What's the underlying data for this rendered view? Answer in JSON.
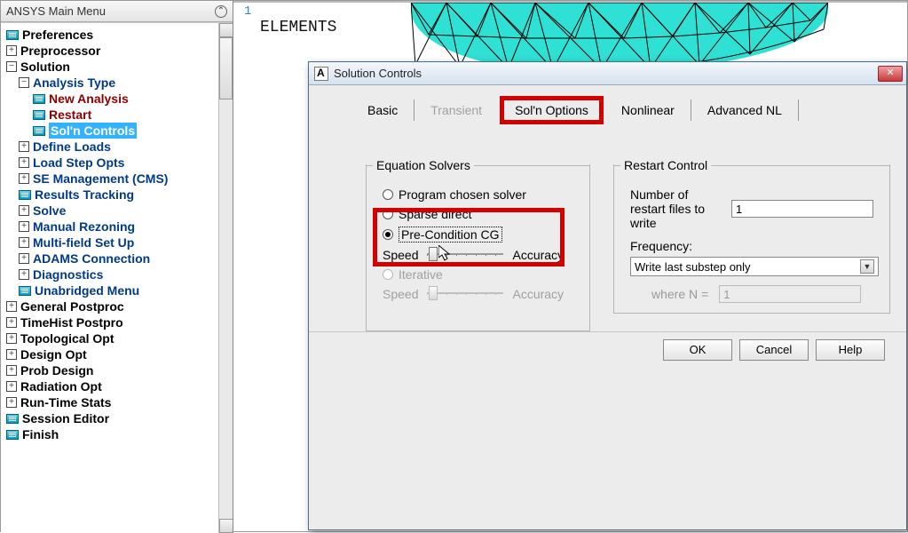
{
  "sidebar": {
    "title": "ANSYS Main Menu",
    "items": [
      {
        "label": "Preferences",
        "type": "leaf",
        "indent": 0
      },
      {
        "label": "Preprocessor",
        "type": "node",
        "indent": 0,
        "sign": "+"
      },
      {
        "label": "Solution",
        "type": "node",
        "indent": 0,
        "sign": "−"
      },
      {
        "label": "Analysis Type",
        "type": "node",
        "indent": 1,
        "sign": "−",
        "cls": "blue"
      },
      {
        "label": "New Analysis",
        "type": "leaf",
        "indent": 2,
        "cls": "red"
      },
      {
        "label": "Restart",
        "type": "leaf",
        "indent": 2,
        "cls": "red"
      },
      {
        "label": "Sol'n Controls",
        "type": "leaf",
        "indent": 2,
        "cls": "sel"
      },
      {
        "label": "Define Loads",
        "type": "node",
        "indent": 1,
        "sign": "+",
        "cls": "blue"
      },
      {
        "label": "Load Step Opts",
        "type": "node",
        "indent": 1,
        "sign": "+",
        "cls": "blue"
      },
      {
        "label": "SE Management (CMS)",
        "type": "node",
        "indent": 1,
        "sign": "+",
        "cls": "blue"
      },
      {
        "label": "Results Tracking",
        "type": "leaf",
        "indent": 1,
        "cls": "blue"
      },
      {
        "label": "Solve",
        "type": "node",
        "indent": 1,
        "sign": "+",
        "cls": "blue"
      },
      {
        "label": "Manual Rezoning",
        "type": "node",
        "indent": 1,
        "sign": "+",
        "cls": "blue"
      },
      {
        "label": "Multi-field Set Up",
        "type": "node",
        "indent": 1,
        "sign": "+",
        "cls": "blue"
      },
      {
        "label": "ADAMS Connection",
        "type": "node",
        "indent": 1,
        "sign": "+",
        "cls": "blue"
      },
      {
        "label": "Diagnostics",
        "type": "node",
        "indent": 1,
        "sign": "+",
        "cls": "blue"
      },
      {
        "label": "Unabridged Menu",
        "type": "leaf",
        "indent": 1,
        "cls": "blue"
      },
      {
        "label": "General Postproc",
        "type": "node",
        "indent": 0,
        "sign": "+"
      },
      {
        "label": "TimeHist Postpro",
        "type": "node",
        "indent": 0,
        "sign": "+"
      },
      {
        "label": "Topological Opt",
        "type": "node",
        "indent": 0,
        "sign": "+"
      },
      {
        "label": "Design Opt",
        "type": "node",
        "indent": 0,
        "sign": "+"
      },
      {
        "label": "Prob Design",
        "type": "node",
        "indent": 0,
        "sign": "+"
      },
      {
        "label": "Radiation Opt",
        "type": "node",
        "indent": 0,
        "sign": "+"
      },
      {
        "label": "Run-Time Stats",
        "type": "node",
        "indent": 0,
        "sign": "+"
      },
      {
        "label": "Session Editor",
        "type": "leaf",
        "indent": 0
      },
      {
        "label": "Finish",
        "type": "leaf",
        "indent": 0
      }
    ]
  },
  "viewport": {
    "line_num": "1",
    "label": "ELEMENTS"
  },
  "dialog": {
    "title": "Solution Controls",
    "tabs": {
      "basic": "Basic",
      "transient": "Transient",
      "soln": "Sol'n Options",
      "nonlinear": "Nonlinear",
      "adv": "Advanced NL"
    },
    "eq_solvers": {
      "legend": "Equation Solvers",
      "program": "Program chosen solver",
      "sparse": "Sparse direct",
      "pcg": "Pre-Condition CG",
      "iterative": "Iterative",
      "speed": "Speed",
      "accuracy": "Accuracy"
    },
    "restart": {
      "legend": "Restart Control",
      "nfiles_label": "Number of restart files to write",
      "nfiles_value": "1",
      "freq_label": "Frequency:",
      "freq_value": "Write last substep only",
      "where_n": "where N =",
      "where_n_value": "1"
    },
    "buttons": {
      "ok": "OK",
      "cancel": "Cancel",
      "help": "Help"
    }
  }
}
